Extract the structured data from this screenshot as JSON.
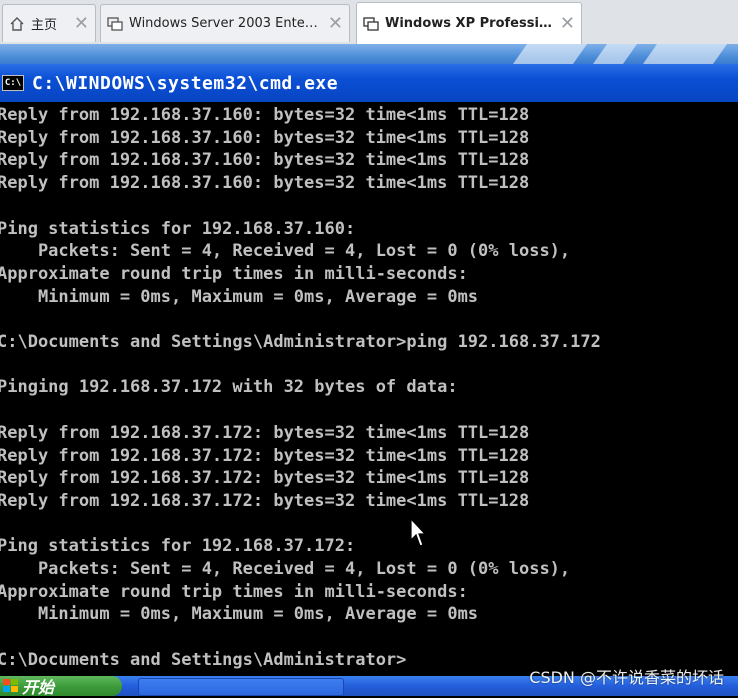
{
  "tabs": [
    {
      "label": "主页",
      "icon": "home-icon"
    },
    {
      "label": "Windows Server 2003 Enterpris...",
      "icon": "vm-icon"
    },
    {
      "label": "Windows XP Professional",
      "icon": "vm-icon",
      "active": true
    }
  ],
  "window": {
    "title": "C:\\WINDOWS\\system32\\cmd.exe",
    "icon_text": "C:\\"
  },
  "console": {
    "lines": [
      "Reply from 192.168.37.160: bytes=32 time<1ms TTL=128",
      "Reply from 192.168.37.160: bytes=32 time<1ms TTL=128",
      "Reply from 192.168.37.160: bytes=32 time<1ms TTL=128",
      "Reply from 192.168.37.160: bytes=32 time<1ms TTL=128",
      "",
      "Ping statistics for 192.168.37.160:",
      "    Packets: Sent = 4, Received = 4, Lost = 0 (0% loss),",
      "Approximate round trip times in milli-seconds:",
      "    Minimum = 0ms, Maximum = 0ms, Average = 0ms",
      "",
      "C:\\Documents and Settings\\Administrator>ping 192.168.37.172",
      "",
      "Pinging 192.168.37.172 with 32 bytes of data:",
      "",
      "Reply from 192.168.37.172: bytes=32 time<1ms TTL=128",
      "Reply from 192.168.37.172: bytes=32 time<1ms TTL=128",
      "Reply from 192.168.37.172: bytes=32 time<1ms TTL=128",
      "Reply from 192.168.37.172: bytes=32 time<1ms TTL=128",
      "",
      "Ping statistics for 192.168.37.172:",
      "    Packets: Sent = 4, Received = 4, Lost = 0 (0% loss),",
      "Approximate round trip times in milli-seconds:",
      "    Minimum = 0ms, Maximum = 0ms, Average = 0ms",
      "",
      "C:\\Documents and Settings\\Administrator>"
    ]
  },
  "taskbar": {
    "start_label": "开始"
  },
  "watermark": "CSDN @不许说香菜的坏话"
}
